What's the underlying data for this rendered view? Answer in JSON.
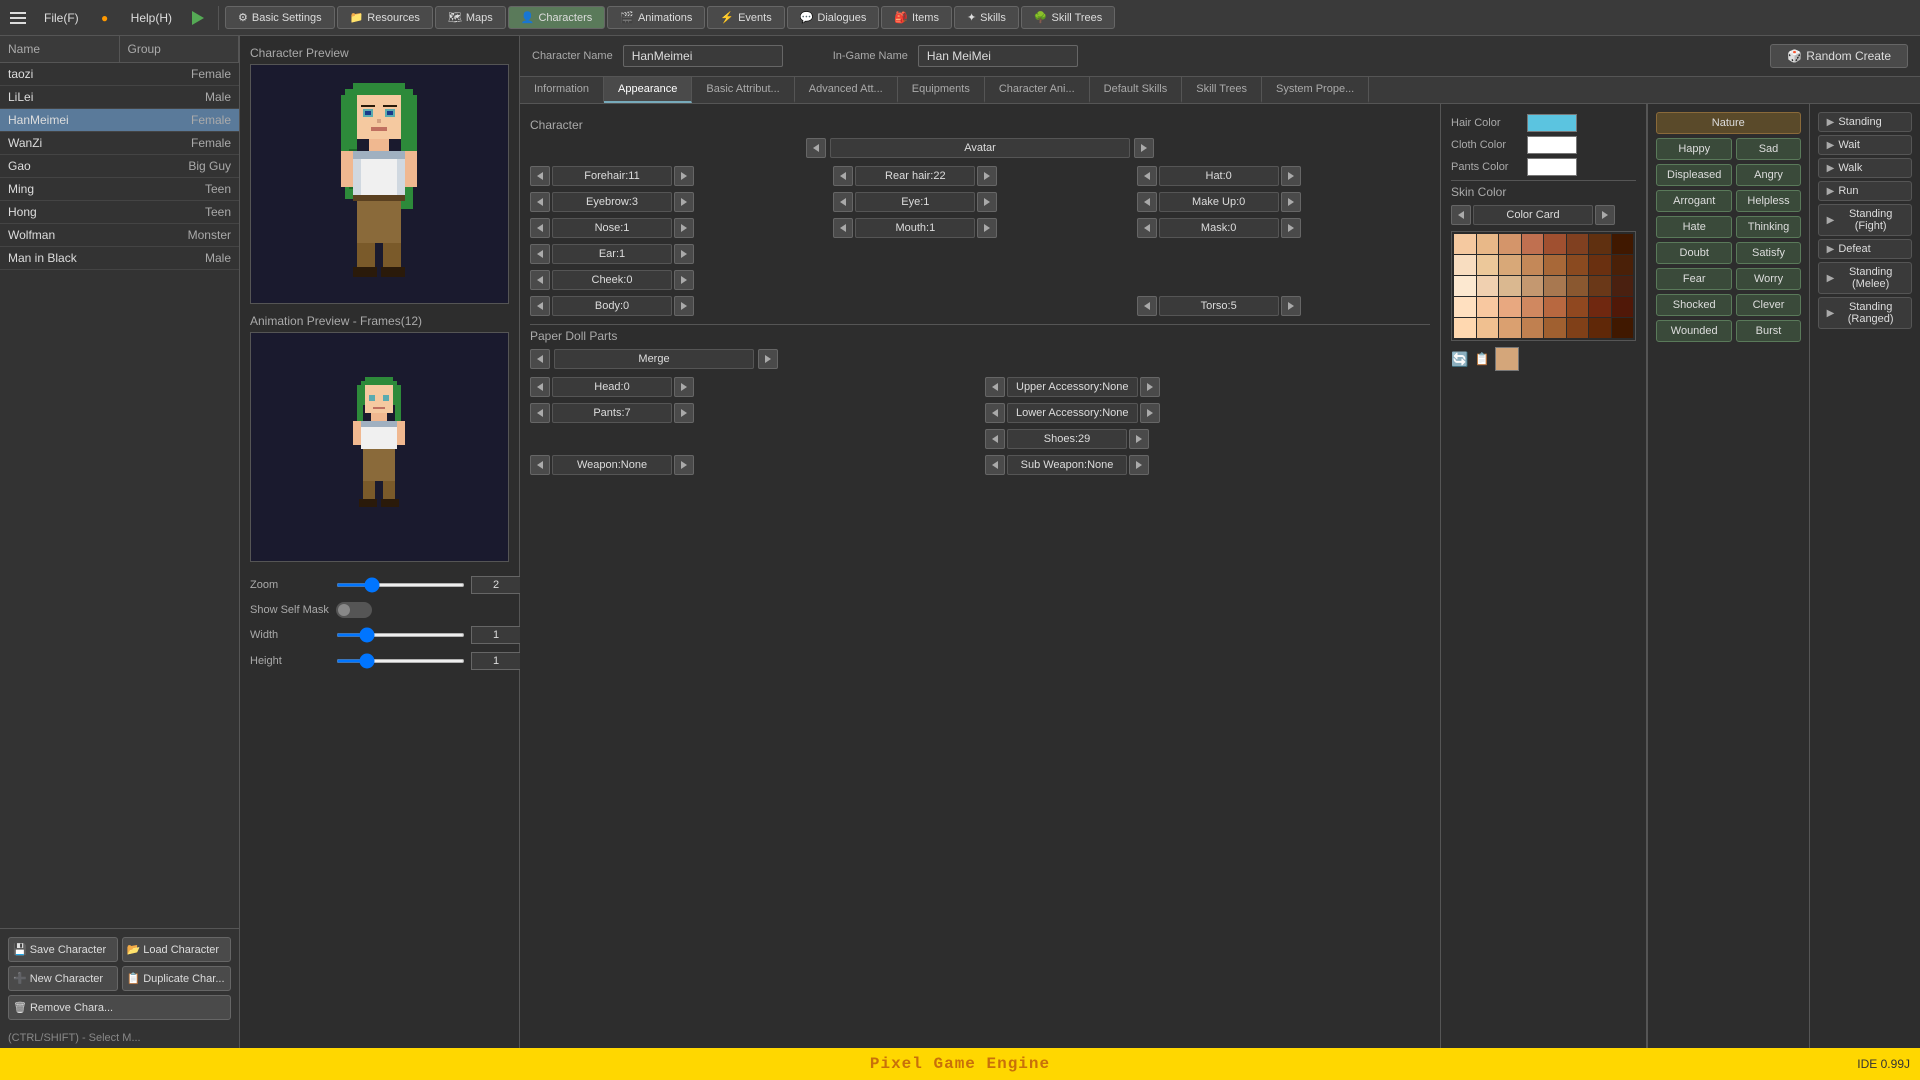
{
  "menubar": {
    "items": [
      {
        "label": "≡",
        "icon": "menu-icon"
      },
      {
        "label": "File(F)"
      },
      {
        "label": "●",
        "icon": "circle-icon"
      },
      {
        "label": "Help(H)"
      },
      {
        "label": "▶",
        "icon": "play-icon"
      }
    ],
    "tabs": [
      {
        "label": "Basic Settings",
        "icon": "⚙"
      },
      {
        "label": "Resources",
        "icon": "📁"
      },
      {
        "label": "Maps",
        "icon": "🗺"
      },
      {
        "label": "Characters",
        "icon": "👤",
        "active": true
      },
      {
        "label": "Animations",
        "icon": "🎬"
      },
      {
        "label": "Events",
        "icon": "⚡"
      },
      {
        "label": "Dialogues",
        "icon": "💬"
      },
      {
        "label": "Items",
        "icon": "🎒"
      },
      {
        "label": "Skills",
        "icon": "✦"
      },
      {
        "label": "Skill Trees",
        "icon": "🌳"
      }
    ]
  },
  "sidebar": {
    "headers": [
      "Name",
      "Group"
    ],
    "characters": [
      {
        "name": "taozi",
        "group": "Female"
      },
      {
        "name": "LiLei",
        "group": "Male"
      },
      {
        "name": "HanMeimei",
        "group": "Female",
        "active": true
      },
      {
        "name": "WanZi",
        "group": "Female"
      },
      {
        "name": "Gao",
        "group": "Big Guy"
      },
      {
        "name": "Ming",
        "group": "Teen"
      },
      {
        "name": "Hong",
        "group": "Teen"
      },
      {
        "name": "Wolfman",
        "group": "Monster"
      },
      {
        "name": "Man in Black",
        "group": "Male"
      }
    ],
    "buttons": [
      {
        "label": "Save Character",
        "icon": "💾"
      },
      {
        "label": "Load Character",
        "icon": "📂"
      },
      {
        "label": "New Character",
        "icon": "➕"
      },
      {
        "label": "Duplicate Char...",
        "icon": "📋"
      },
      {
        "label": "Remove Chara...",
        "icon": "🗑"
      }
    ],
    "status": "(CTRL/SHIFT) - Select M..."
  },
  "characterInfo": {
    "characterNameLabel": "Character Name",
    "characterNameValue": "HanMeimei",
    "inGameNameLabel": "In-Game Name",
    "inGameNameValue": "Han MeiMei",
    "randomBtnLabel": "Random Create"
  },
  "tabs": {
    "main": [
      {
        "label": "Information"
      },
      {
        "label": "Appearance",
        "active": true
      },
      {
        "label": "Basic Attribut..."
      },
      {
        "label": "Advanced Att..."
      },
      {
        "label": "Equipments"
      },
      {
        "label": "Character Ani..."
      },
      {
        "label": "Default Skills"
      },
      {
        "label": "Skill Trees"
      },
      {
        "label": "System Prope..."
      }
    ]
  },
  "appearance": {
    "characterSection": "Character",
    "avatarLabel": "Avatar",
    "fields": [
      {
        "label": "Forehair:11",
        "col": 0,
        "row": 0
      },
      {
        "label": "Rear hair:22",
        "col": 1,
        "row": 0
      },
      {
        "label": "Hat:0",
        "col": 2,
        "row": 0
      },
      {
        "label": "Eyebrow:3",
        "col": 0,
        "row": 1
      },
      {
        "label": "Eye:1",
        "col": 1,
        "row": 1
      },
      {
        "label": "Make Up:0",
        "col": 2,
        "row": 1
      },
      {
        "label": "Nose:1",
        "col": 0,
        "row": 2
      },
      {
        "label": "Mouth:1",
        "col": 1,
        "row": 2
      },
      {
        "label": "Mask:0",
        "col": 2,
        "row": 2
      },
      {
        "label": "Ear:1",
        "col": 0,
        "row": 3
      },
      {
        "label": "Cheek:0",
        "col": 0,
        "row": 4
      },
      {
        "label": "Body:0",
        "col": 0,
        "row": 5
      },
      {
        "label": "Torso:5",
        "col": 2,
        "row": 5
      }
    ],
    "paperDollSection": "Paper Doll Parts",
    "mergeLabel": "Merge",
    "paperDollFields": [
      {
        "label": "Head:0",
        "col": 0,
        "row": 0
      },
      {
        "label": "Upper Accessory:None",
        "col": 1,
        "row": 0
      },
      {
        "label": "Pants:7",
        "col": 0,
        "row": 1
      },
      {
        "label": "Lower Accessory:None",
        "col": 1,
        "row": 1
      },
      {
        "label": "Shoes:29",
        "col": 1,
        "row": 2
      },
      {
        "label": "Weapon:None",
        "col": 0,
        "row": 3
      },
      {
        "label": "Sub Weapon:None",
        "col": 1,
        "row": 3
      }
    ]
  },
  "colors": {
    "hairColorLabel": "Hair Color",
    "hairColorValue": "#5bc4e0",
    "clothColorLabel": "Cloth Color",
    "clothColorValue": "#ffffff",
    "pantsColorLabel": "Pants Color",
    "pantsColorValue": "#ffffff",
    "skinColorLabel": "Skin Color",
    "colorCardLabel": "Color Card",
    "skinSwatches": [
      "#f5c9a0",
      "#e8b888",
      "#d4956a",
      "#c07050",
      "#a05030",
      "#804020",
      "#603010",
      "#401800",
      "#f8ddc0",
      "#ecc89a",
      "#d8a878",
      "#c48858",
      "#a86838",
      "#8a4a20",
      "#6a3010",
      "#4a2008",
      "#fce8d0",
      "#f0d0b0",
      "#dab890",
      "#c49870",
      "#a87850",
      "#8a5830",
      "#6a3818",
      "#4a2010",
      "#ffe0c0",
      "#f8c8a0",
      "#e8a880",
      "#d08860",
      "#b86840",
      "#904820",
      "#702810",
      "#501808",
      "#ffd8b0",
      "#f0c090",
      "#daa070",
      "#c08050",
      "#a06030",
      "#804018",
      "#602808",
      "#401800"
    ],
    "selectedSkinColor": "#d4a67a",
    "refreshIcon": "🔄",
    "copyIcon": "📋"
  },
  "emotions": {
    "specialLabel": "Nature",
    "buttons": [
      {
        "label": "Happy",
        "row": 0,
        "col": 0
      },
      {
        "label": "Sad",
        "row": 0,
        "col": 1
      },
      {
        "label": "Displeased",
        "row": 1,
        "col": 0
      },
      {
        "label": "Angry",
        "row": 1,
        "col": 1
      },
      {
        "label": "Arrogant",
        "row": 2,
        "col": 0
      },
      {
        "label": "Helpless",
        "row": 2,
        "col": 1
      },
      {
        "label": "Hate",
        "row": 3,
        "col": 0
      },
      {
        "label": "Thinking",
        "row": 3,
        "col": 1
      },
      {
        "label": "Doubt",
        "row": 4,
        "col": 0
      },
      {
        "label": "Satisfy",
        "row": 4,
        "col": 1
      },
      {
        "label": "Fear",
        "row": 5,
        "col": 0
      },
      {
        "label": "Worry",
        "row": 5,
        "col": 1
      },
      {
        "label": "Shocked",
        "row": 6,
        "col": 0
      },
      {
        "label": "Clever",
        "row": 6,
        "col": 1
      },
      {
        "label": "Wounded",
        "row": 7,
        "col": 0
      },
      {
        "label": "Burst",
        "row": 7,
        "col": 1
      }
    ]
  },
  "animations": {
    "buttons": [
      {
        "label": "Standing"
      },
      {
        "label": "Wait"
      },
      {
        "label": "Walk"
      },
      {
        "label": "Run"
      },
      {
        "label": "Standing (Fight)"
      },
      {
        "label": "Defeat"
      },
      {
        "label": "Standing (Melee)"
      },
      {
        "label": "Standing (Ranged)"
      }
    ]
  },
  "centerPanel": {
    "charPreviewTitle": "Character Preview",
    "animPreviewTitle": "Animation Preview - Frames(12)",
    "zoomLabel": "Zoom",
    "zoomValue": "2",
    "showSelfMaskLabel": "Show Self Mask",
    "widthLabel": "Width",
    "widthValue": "1",
    "heightLabel": "Height",
    "heightValue": "1"
  },
  "statusBar": {
    "engineName": "Pixel Game Engine",
    "ideVersion": "IDE 0.99J"
  }
}
